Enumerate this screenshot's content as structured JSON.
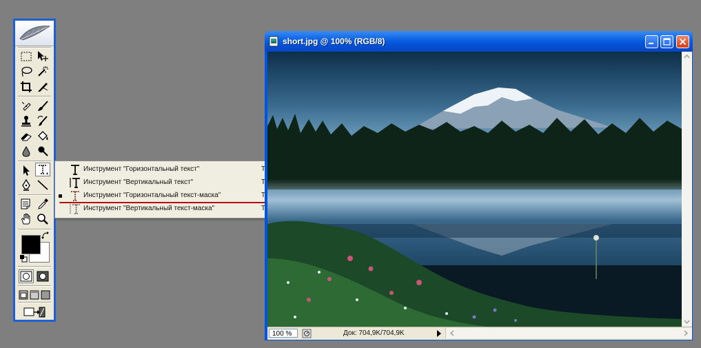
{
  "toolbox": {
    "tools": [
      {
        "name": "rect-marquee-icon"
      },
      {
        "name": "move-icon"
      },
      {
        "name": "lasso-icon"
      },
      {
        "name": "magic-wand-icon"
      },
      {
        "name": "crop-icon"
      },
      {
        "name": "slice-icon"
      },
      {
        "name": "healing-brush-icon"
      },
      {
        "name": "brush-icon"
      },
      {
        "name": "clone-stamp-icon"
      },
      {
        "name": "history-brush-icon"
      },
      {
        "name": "eraser-icon"
      },
      {
        "name": "paint-bucket-icon"
      },
      {
        "name": "blur-icon"
      },
      {
        "name": "dodge-icon"
      },
      {
        "name": "path-select-icon"
      },
      {
        "name": "type-icon"
      },
      {
        "name": "pen-icon"
      },
      {
        "name": "line-icon"
      },
      {
        "name": "notes-icon"
      },
      {
        "name": "eyedropper-icon"
      },
      {
        "name": "hand-icon"
      },
      {
        "name": "zoom-icon"
      }
    ],
    "foreground_color": "#000000",
    "background_color": "#ffffff"
  },
  "flyout": {
    "items": [
      {
        "label": "Инструмент \"Горизонтальный текст\"",
        "shortcut": "T",
        "icon": "horizontal-type-icon",
        "selected": false
      },
      {
        "label": "Инструмент \"Вертикальный текст\"",
        "shortcut": "T",
        "icon": "vertical-type-icon",
        "selected": false
      },
      {
        "label": "Инструмент \"Горизонтальный текст-маска\"",
        "shortcut": "T",
        "icon": "horizontal-type-mask-icon",
        "selected": true
      },
      {
        "label": "Инструмент \"Вертикальный текст-маска\"",
        "shortcut": "T",
        "icon": "vertical-type-mask-icon",
        "selected": false
      }
    ],
    "highlight_color": "#b01010"
  },
  "document": {
    "title": "short.jpg @ 100% (RGB/8)",
    "zoom": "100 %",
    "doc_size": "Док: 704,9K/704,9K"
  }
}
